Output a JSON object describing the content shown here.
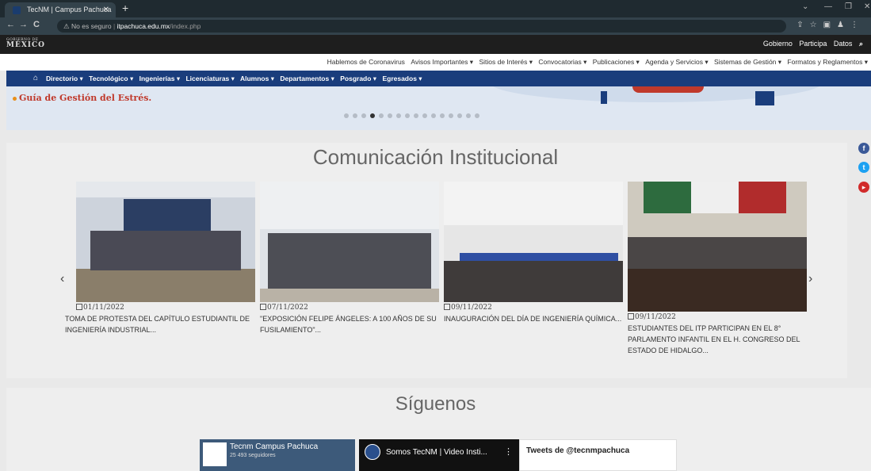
{
  "browser": {
    "tab_title": "TecNM | Campus Pachuca",
    "url_security": "No es seguro",
    "url_host": "itpachuca.edu.mx",
    "url_path": "/index.php"
  },
  "gov": {
    "logo_small": "GOBIERNO DE",
    "logo_big": "MÉXICO",
    "links": [
      "Gobierno",
      "Participa",
      "Datos"
    ]
  },
  "topmenu": [
    "Hablemos de Coronavirus",
    "Avisos Importantes ▾",
    "Sitios de Interés ▾",
    "Convocatorias ▾",
    "Publicaciones ▾",
    "Agenda y Servicios ▾",
    "Sistemas de Gestión ▾",
    "Formatos y Reglamentos ▾"
  ],
  "bluenav": [
    "Directorio ▾",
    "Tecnológico ▾",
    "Ingenierías ▾",
    "Licenciaturas ▾",
    "Alumnos ▾",
    "Departamentos ▾",
    "Posgrado ▾",
    "Egresados ▾"
  ],
  "banner": {
    "text": "Guía de Gestión del Estrés.",
    "slide_count": 16,
    "active_index": 3
  },
  "comunicacion": {
    "title": "Comunicación Institucional",
    "cards": [
      {
        "date": "01/11/2022",
        "text": "TOMA DE PROTESTA DEL CAPÍTULO ESTUDIANTIL DE INGENIERÍA INDUSTRIAL..."
      },
      {
        "date": "07/11/2022",
        "text": "\"EXPOSICIÓN FELIPE ÁNGELES: A 100 AÑOS DE SU FUSILAMIENTO\"..."
      },
      {
        "date": "09/11/2022",
        "text": "INAUGURACIÓN DEL DÍA DE INGENIERÍA QUÍMICA..."
      },
      {
        "date": "09/11/2022",
        "text": "ESTUDIANTES DEL ITP PARTICIPAN EN EL 8° PARLAMENTO INFANTIL EN EL H. CONGRESO DEL ESTADO DE HIDALGO..."
      }
    ]
  },
  "siguenos": {
    "title": "Síguenos",
    "facebook_name": "Tecnm Campus Pachuca",
    "facebook_followers": "25 493 seguidores",
    "youtube_title": "Somos TecNM | Video Insti...",
    "twitter_title": "Tweets de @tecnmpachuca"
  }
}
